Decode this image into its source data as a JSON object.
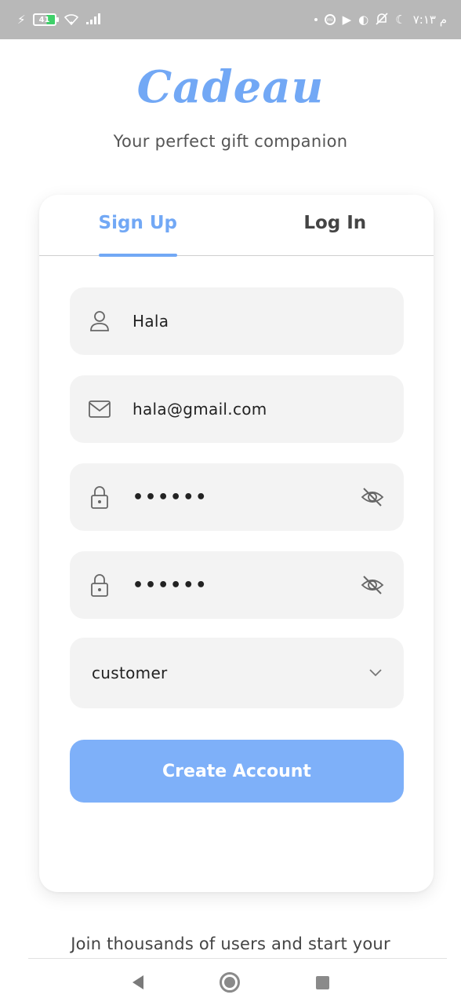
{
  "status_bar": {
    "battery_level": "41",
    "time": "م ٧:١٣"
  },
  "app": {
    "logo": "Cadeau",
    "tagline": "Your perfect gift companion"
  },
  "tabs": [
    {
      "label": "Sign Up",
      "active": true
    },
    {
      "label": "Log In",
      "active": false
    }
  ],
  "form": {
    "name_value": "Hala",
    "email_value": "hala@gmail.com",
    "password_value": "••••••",
    "confirm_password_value": "••••••",
    "role_selected": "customer",
    "submit_label": "Create Account"
  },
  "footer": {
    "join_text": "Join thousands of users and start your"
  },
  "colors": {
    "accent": "#72a8f5",
    "button": "#7eb0f9",
    "field_bg": "#f3f3f3"
  }
}
